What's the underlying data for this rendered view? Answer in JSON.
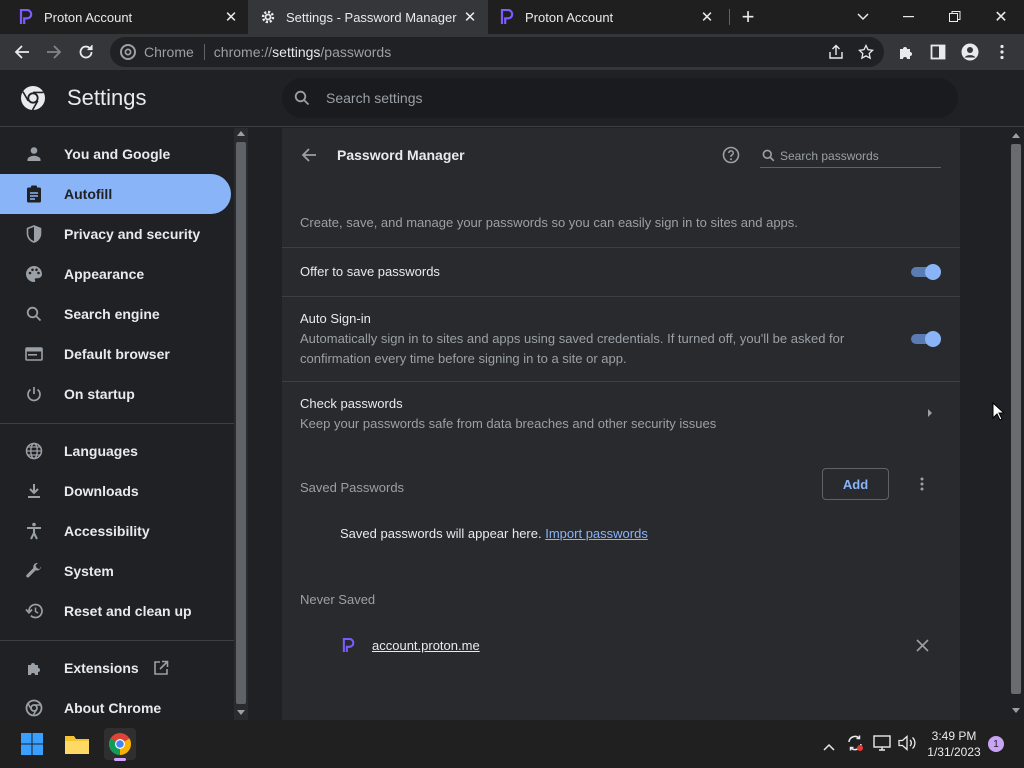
{
  "tabs": [
    {
      "title": "Proton Account",
      "close": "✕"
    },
    {
      "title": "Settings - Password Manager",
      "close": "✕"
    },
    {
      "title": "Proton Account",
      "close": "✕"
    }
  ],
  "window_controls": {
    "new_tab": "+",
    "tab_search": "⌄",
    "minimize": "—",
    "restore": "❐",
    "close": "✕"
  },
  "omnibox": {
    "chip": "Chrome",
    "url_prefix": "chrome://",
    "url_host": "settings",
    "url_path": "/passwords"
  },
  "settings": {
    "title": "Settings",
    "search_placeholder": "Search settings"
  },
  "sidebar": {
    "items": [
      {
        "label": "You and Google",
        "icon": "person-icon"
      },
      {
        "label": "Autofill",
        "icon": "clipboard-icon"
      },
      {
        "label": "Privacy and security",
        "icon": "shield-icon"
      },
      {
        "label": "Appearance",
        "icon": "palette-icon"
      },
      {
        "label": "Search engine",
        "icon": "search-icon"
      },
      {
        "label": "Default browser",
        "icon": "browser-icon"
      },
      {
        "label": "On startup",
        "icon": "power-icon"
      },
      {
        "label": "Languages",
        "icon": "globe-icon"
      },
      {
        "label": "Downloads",
        "icon": "download-icon"
      },
      {
        "label": "Accessibility",
        "icon": "accessibility-icon"
      },
      {
        "label": "System",
        "icon": "wrench-icon"
      },
      {
        "label": "Reset and clean up",
        "icon": "history-icon"
      },
      {
        "label": "Extensions",
        "icon": "puzzle-icon"
      },
      {
        "label": "About Chrome",
        "icon": "chrome-icon"
      }
    ],
    "active_index": 1
  },
  "password_manager": {
    "title": "Password Manager",
    "search_placeholder": "Search passwords",
    "description": "Create, save, and manage your passwords so you can easily sign in to sites and apps.",
    "offer_to_save": {
      "label": "Offer to save passwords",
      "enabled": true
    },
    "auto_signin": {
      "label": "Auto Sign-in",
      "desc_line1": "Automatically sign in to sites and apps using saved credentials. If turned off, you'll be asked for",
      "desc_line2": "confirmation every time before signing in to a site or app.",
      "enabled": true
    },
    "check_passwords": {
      "label": "Check passwords",
      "desc": "Keep your passwords safe from data breaches and other security issues"
    },
    "saved_passwords": {
      "heading": "Saved Passwords",
      "add_label": "Add",
      "empty_text": "Saved passwords will appear here.",
      "import_link": "Import passwords"
    },
    "never_saved": {
      "heading": "Never Saved",
      "sites": [
        "account.proton.me"
      ]
    }
  },
  "taskbar": {
    "time": "3:49 PM",
    "date": "1/31/2023",
    "notification_count": "1"
  },
  "colors": {
    "accent": "#8ab4f8",
    "proton": "#6d4aff",
    "background": "#202124",
    "card": "#292a2d"
  }
}
